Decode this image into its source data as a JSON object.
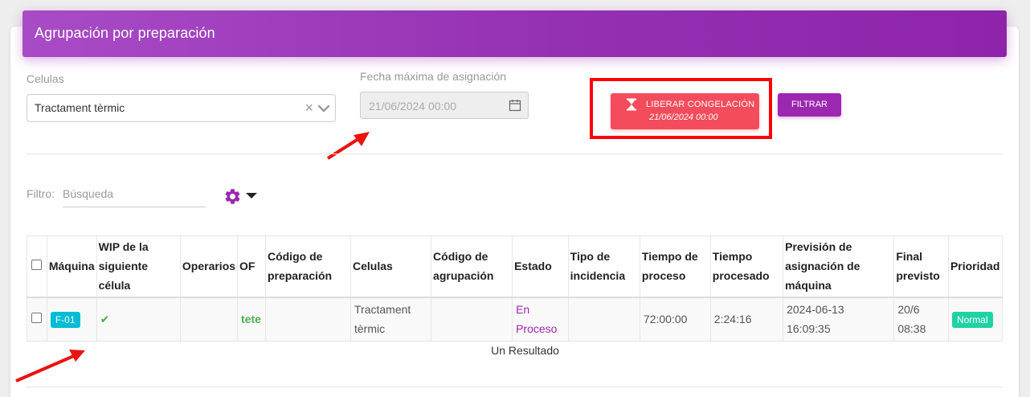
{
  "header": {
    "title": "Agrupación por preparación"
  },
  "filters": {
    "celulas_label": "Celulas",
    "celulas_value": "Tractament tèrmic",
    "fecha_label": "Fecha máxima de asignación",
    "fecha_value": "21/06/2024 00:00",
    "liberar_label": "LIBERAR CONGELACIÓN",
    "liberar_date": "21/06/2024 00:00",
    "filtrar_label": "FILTRAR"
  },
  "search": {
    "label": "Filtro:",
    "placeholder": "Búsqueda"
  },
  "table": {
    "headers": [
      "Máquina",
      "WIP de la siguiente célula",
      "Operarios",
      "OF",
      "Código de preparación",
      "Celulas",
      "Código de agrupación",
      "Estado",
      "Tipo de incidencia",
      "Tiempo de proceso",
      "Tiempo procesado",
      "Previsión de asignación de máquina",
      "Final previsto",
      "Prioridad"
    ],
    "rows": [
      {
        "maquina": "F-01",
        "wip": "✔",
        "operarios": "",
        "of": "tete",
        "codigo_preparacion": "",
        "celulas": "Tractament tèrmic",
        "codigo_agrupacion": "",
        "estado": "En Proceso",
        "tipo_incidencia": "",
        "tiempo_proceso": "72:00:00",
        "tiempo_procesado": "2:24:16",
        "prevision": "2024-06-13 16:09:35",
        "final_previsto": "20/6 08:38",
        "prioridad": "Normal"
      }
    ]
  },
  "result_text": "Un Resultado",
  "colors": {
    "header": "#9c27b0",
    "danger": "#f44c5c",
    "info": "#00bcd4",
    "success": "#1ed2a5"
  }
}
